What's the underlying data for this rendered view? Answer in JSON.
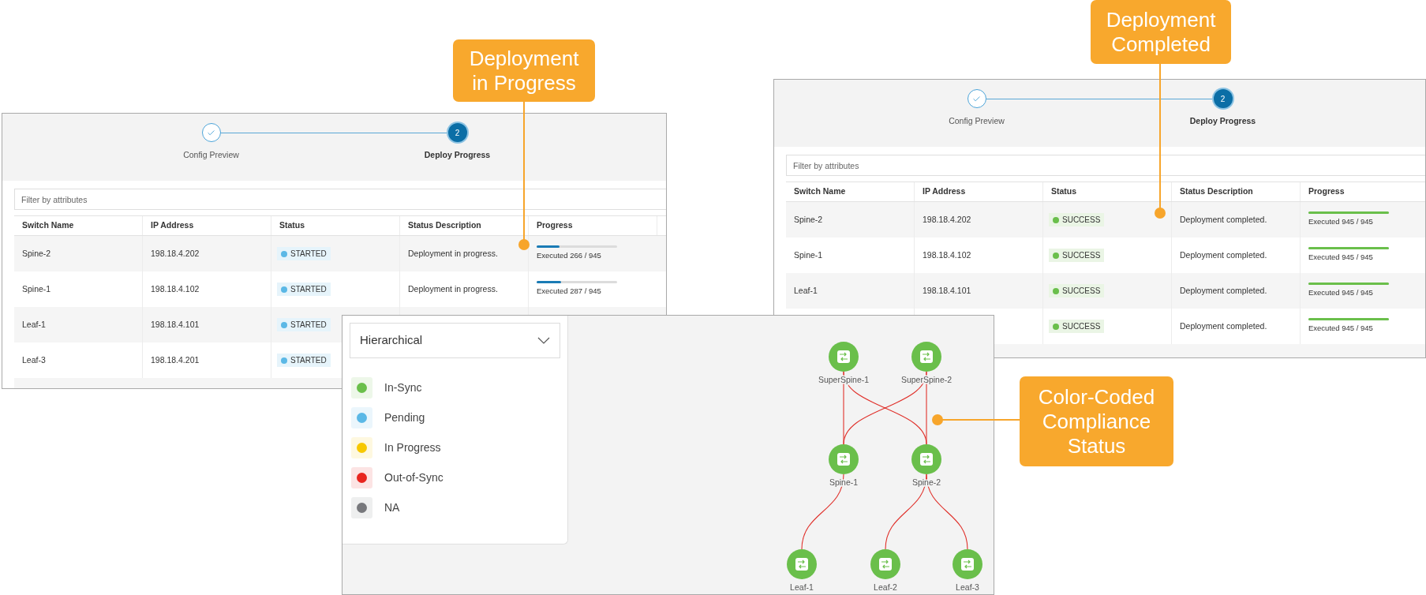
{
  "deploy_panels": [
    {
      "steps": [
        {
          "label": "Config Preview",
          "done": true,
          "selected": false
        },
        {
          "label": "Deploy Progress",
          "number": "2",
          "done": false,
          "selected": true
        }
      ],
      "filter": {
        "placeholder": "Filter by attributes"
      },
      "columns": [
        "Switch Name",
        "IP Address",
        "Status",
        "Status Description",
        "Progress"
      ],
      "rows": [
        {
          "switch": "Spine-2",
          "ip": "198.18.4.202",
          "status": {
            "text": "STARTED",
            "kind": "started"
          },
          "description": "Deployment in progress.",
          "progress": {
            "level": 0.28,
            "reading": "Executed 266 / 945"
          }
        },
        {
          "switch": "Spine-1",
          "ip": "198.18.4.102",
          "status": {
            "text": "STARTED",
            "kind": "started"
          },
          "description": "Deployment in progress.",
          "progress": {
            "level": 0.3,
            "reading": "Executed 287 / 945"
          }
        },
        {
          "switch": "Leaf-1",
          "ip": "198.18.4.101",
          "status": {
            "text": "STARTED",
            "kind": "started"
          }
        },
        {
          "switch": "Leaf-3",
          "ip": "198.18.4.201",
          "status": {
            "text": "STARTED",
            "kind": "started"
          }
        }
      ]
    },
    {
      "steps": [
        {
          "label": "Config Preview",
          "done": true,
          "selected": false
        },
        {
          "label": "Deploy Progress",
          "number": "2",
          "done": false,
          "selected": true
        }
      ],
      "filter": {
        "placeholder": "Filter by attributes"
      },
      "columns": [
        "Switch Name",
        "IP Address",
        "Status",
        "Status Description",
        "Progress"
      ],
      "rows": [
        {
          "switch": "Spine-2",
          "ip": "198.18.4.202",
          "status": {
            "text": "SUCCESS",
            "kind": "success"
          },
          "description": "Deployment completed.",
          "progress": {
            "level": 1,
            "reading": "Executed 945 / 945"
          }
        },
        {
          "switch": "Spine-1",
          "ip": "198.18.4.102",
          "status": {
            "text": "SUCCESS",
            "kind": "success"
          },
          "description": "Deployment completed.",
          "progress": {
            "level": 1,
            "reading": "Executed 945 / 945"
          }
        },
        {
          "switch": "Leaf-1",
          "ip": "198.18.4.101",
          "status": {
            "text": "SUCCESS",
            "kind": "success"
          },
          "description": "Deployment completed.",
          "progress": {
            "level": 1,
            "reading": "Executed 945 / 945"
          }
        },
        {
          "status": {
            "text": "SUCCESS",
            "kind": "success"
          },
          "description": "Deployment completed.",
          "progress": {
            "level": 1,
            "reading": "Executed 945 / 945"
          }
        }
      ]
    }
  ],
  "topology": {
    "layout": {
      "value": "Hierarchical"
    },
    "legend": [
      {
        "label": "In-Sync",
        "color": "#6abf4b"
      },
      {
        "label": "Pending",
        "color": "#5bb8e6"
      },
      {
        "label": "In Progress",
        "color": "#f7c800"
      },
      {
        "label": "Out-of-Sync",
        "color": "#e8251f"
      },
      {
        "label": "NA",
        "color": "#77787c"
      }
    ],
    "nodes": [
      {
        "name": "SuperSpine-1"
      },
      {
        "name": "SuperSpine-2"
      },
      {
        "name": "Spine-1"
      },
      {
        "name": "Spine-2"
      },
      {
        "name": "Leaf-1"
      },
      {
        "name": "Leaf-2"
      },
      {
        "name": "Leaf-3"
      }
    ]
  },
  "callouts": [
    {
      "text": "Deployment\nin Progress"
    },
    {
      "text": "Deployment\nCompleted"
    },
    {
      "text": "Color-Coded\nCompliance\nStatus"
    }
  ]
}
